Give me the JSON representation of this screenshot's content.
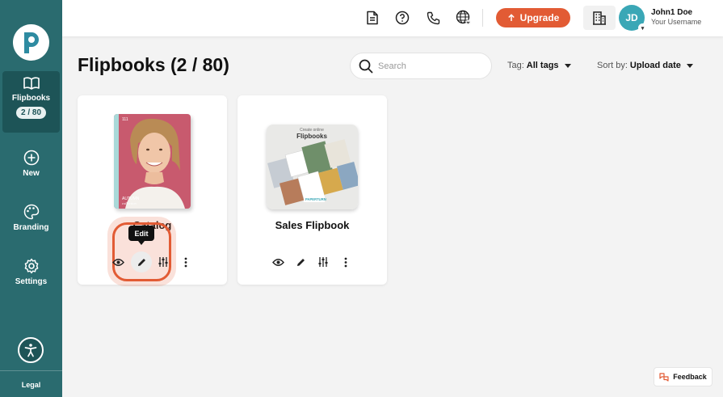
{
  "sidebar": {
    "logo": "papertype-logo",
    "items": [
      {
        "label": "Flipbooks",
        "badge": "2 / 80",
        "icon": "book-open-icon",
        "active": true
      },
      {
        "label": "New",
        "icon": "plus-circle-icon"
      },
      {
        "label": "Branding",
        "icon": "palette-icon"
      },
      {
        "label": "Settings",
        "icon": "gear-icon"
      }
    ],
    "accessibility_icon": "accessibility-icon",
    "legal_label": "Legal"
  },
  "topbar": {
    "icons": [
      "document-icon",
      "help-icon",
      "phone-icon",
      "globe-icon"
    ],
    "upgrade_label": "Upgrade",
    "organization_icon": "building-icon",
    "user": {
      "initials": "JD",
      "name": "John1 Doe",
      "subtitle": "Your Username"
    }
  },
  "main": {
    "title": "Flipbooks (2 / 80)",
    "search": {
      "placeholder": "Search"
    },
    "tag_filter": {
      "label": "Tag:",
      "value": "All tags"
    },
    "sort": {
      "label": "Sort by:",
      "value": "Upload date"
    },
    "flipbooks": [
      {
        "title": "Catalog",
        "cover": {
          "top_text": "111",
          "bottom_line1": "AUTUMN",
          "bottom_line2": "collection"
        },
        "actions": [
          "eye-icon",
          "pencil-icon",
          "sliders-icon",
          "more-vertical-icon"
        ],
        "tooltip": "Edit"
      },
      {
        "title": "Sales Flipbook",
        "cover": {
          "top_small": "Create online",
          "top_big": "Flipbooks",
          "brand": "PAPERTURN"
        },
        "actions": [
          "eye-icon",
          "pencil-icon",
          "sliders-icon",
          "more-vertical-icon"
        ]
      }
    ]
  },
  "feedback_label": "Feedback",
  "colors": {
    "sidebar": "#2a6b6f",
    "sidebar_active": "#1d5457",
    "accent": "#e25b34",
    "avatar": "#3aa7b6"
  }
}
